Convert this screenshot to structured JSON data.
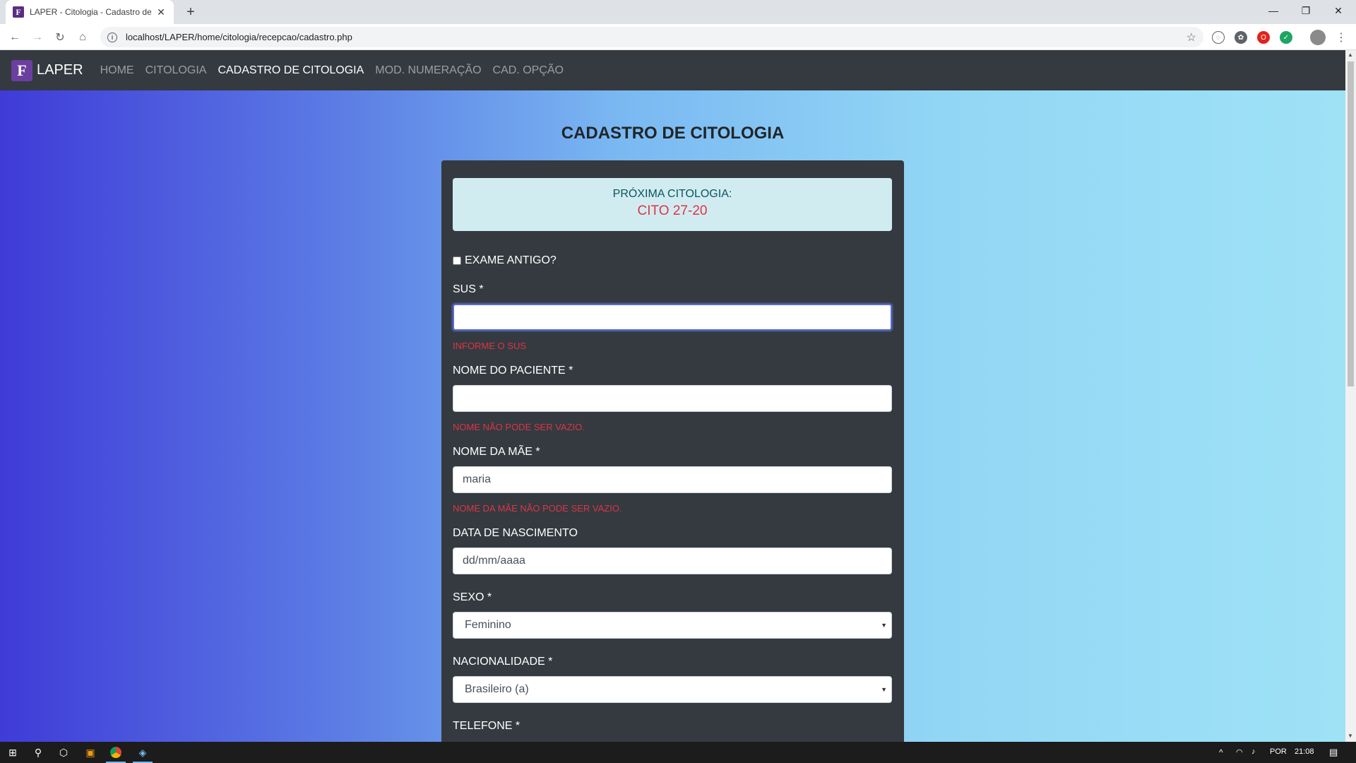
{
  "browser": {
    "tab_title": "LAPER - Citologia - Cadastro de Citologia",
    "tab_favicon": "F",
    "url": "localhost/LAPER/home/citologia/recepcao/cadastro.php"
  },
  "navbar": {
    "brand_logo": "F",
    "brand": "LAPER",
    "links": [
      "HOME",
      "CITOLOGIA",
      "CADASTRO DE CITOLOGIA",
      "MOD. NUMERAÇÃO",
      "CAD. OPÇÃO"
    ],
    "active_index": 2
  },
  "page_title": "CADASTRO DE CITOLOGIA",
  "alert": {
    "label": "PRÓXIMA CITOLOGIA:",
    "value": "CITO 27-20"
  },
  "form": {
    "exame_antigo_label": "EXAME ANTIGO?",
    "exame_antigo_checked": false,
    "sus": {
      "label": "SUS *",
      "value": "",
      "error": "INFORME O SUS"
    },
    "nome_paciente": {
      "label": "NOME DO PACIENTE *",
      "value": "",
      "error": "NOME NÃO PODE SER VAZIO."
    },
    "nome_mae": {
      "label": "NOME DA MÃE *",
      "value": "maria",
      "error": "NOME DA MÃE NÃO PODE SER VAZIO."
    },
    "data_nascimento": {
      "label": "DATA DE NASCIMENTO",
      "placeholder": "dd/mm/aaaa"
    },
    "sexo": {
      "label": "SEXO *",
      "value": "Feminino"
    },
    "nacionalidade": {
      "label": "NACIONALIDADE *",
      "value": "Brasileiro (a)"
    },
    "telefone": {
      "label": "TELEFONE *"
    }
  },
  "taskbar": {
    "language": "POR",
    "time": "21:08"
  },
  "colors": {
    "navbar": "#343a40",
    "card": "#343a40",
    "alert_bg": "#d1ecf1",
    "error": "#dc3545"
  }
}
